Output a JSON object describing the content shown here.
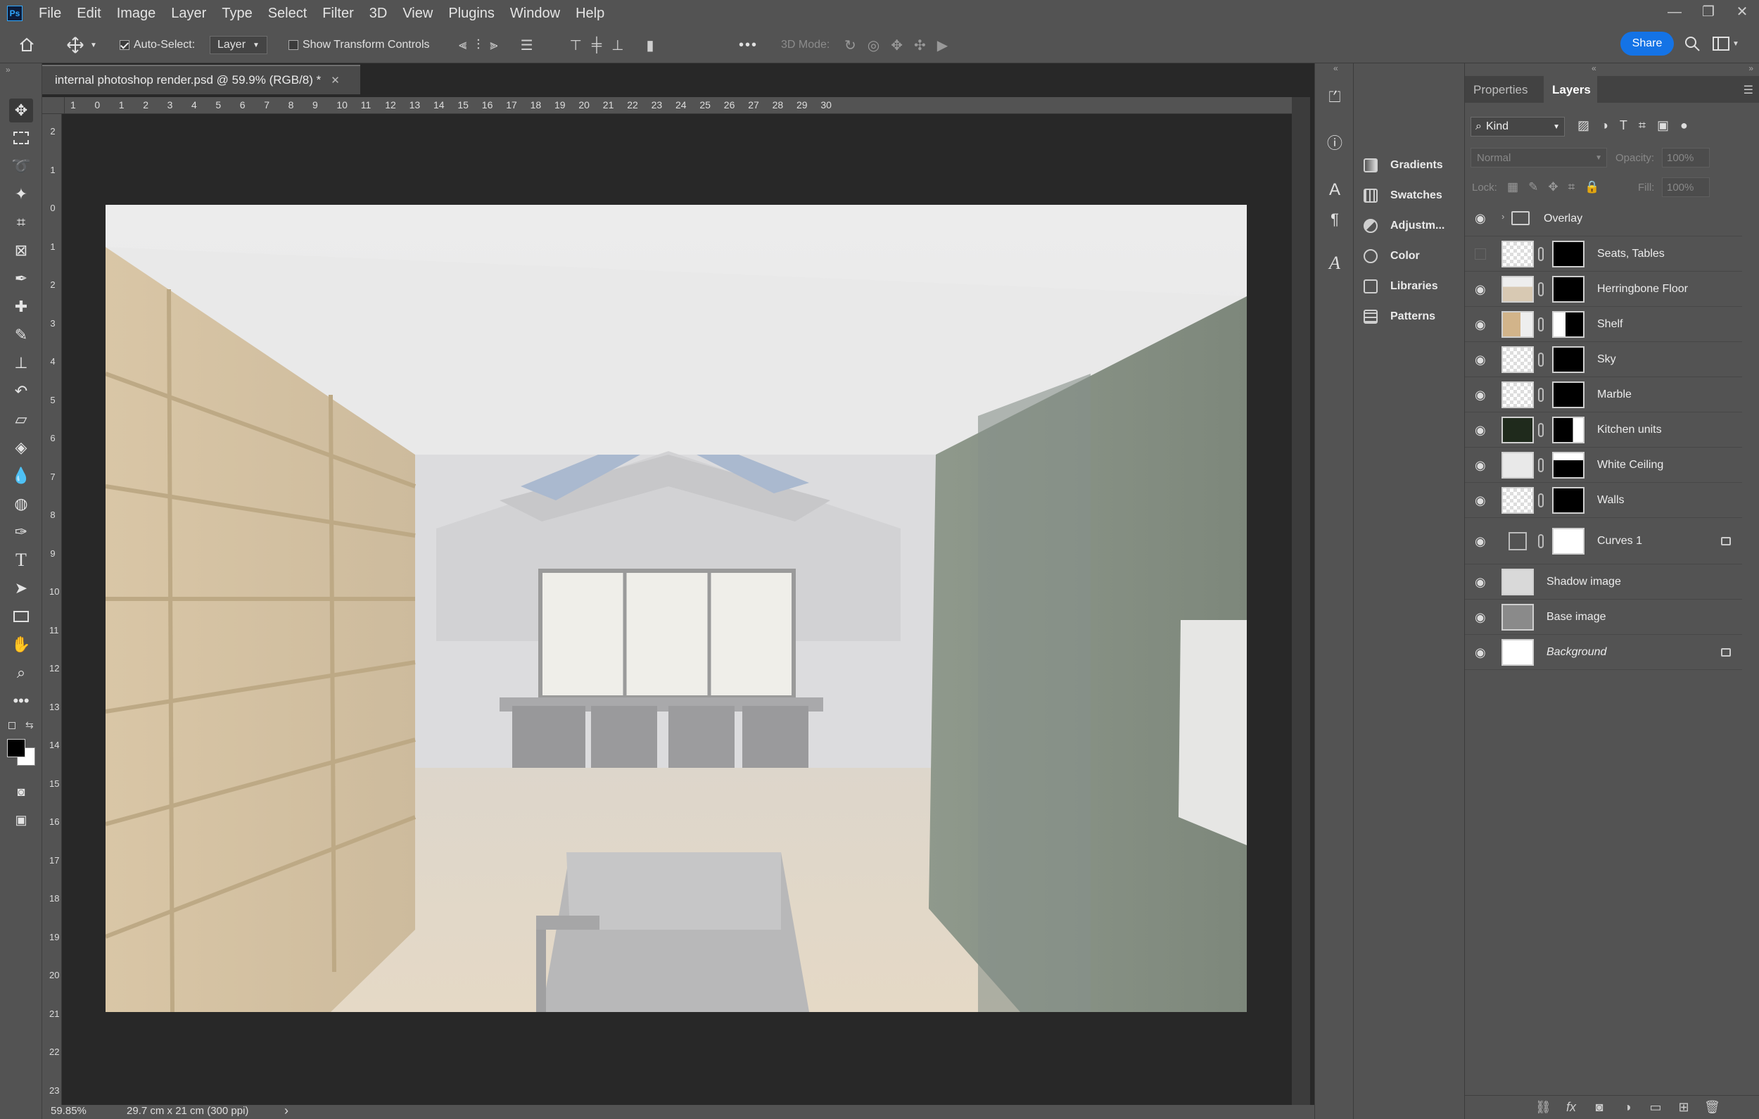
{
  "app": {
    "logo": "Ps"
  },
  "menu": [
    "File",
    "Edit",
    "Image",
    "Layer",
    "Type",
    "Select",
    "Filter",
    "3D",
    "View",
    "Plugins",
    "Window",
    "Help"
  ],
  "window_controls": {
    "minimize": "—",
    "restore": "❐",
    "close": "✕"
  },
  "options_bar": {
    "auto_select_label": "Auto-Select:",
    "auto_select_checked": true,
    "auto_select_target": "Layer",
    "show_transform_label": "Show Transform Controls",
    "show_transform_checked": false,
    "mode_3d_label": "3D Mode:",
    "more_label": "•••",
    "share_label": "Share"
  },
  "document": {
    "tab_title": "internal photoshop render.psd @ 59.9% (RGB/8) *",
    "tab_close": "✕",
    "zoom": "59.85%",
    "doc_size": "29.7 cm x 21 cm (300 ppi)",
    "status_arrow": "›"
  },
  "ruler": {
    "horizontal": [
      "1",
      "0",
      "1",
      "2",
      "3",
      "4",
      "5",
      "6",
      "7",
      "8",
      "9",
      "10",
      "11",
      "12",
      "13",
      "14",
      "15",
      "16",
      "17",
      "18",
      "19",
      "20",
      "21",
      "22",
      "23",
      "24",
      "25",
      "26",
      "27",
      "28",
      "29",
      "30"
    ],
    "vertical": [
      "2",
      "1",
      "0",
      "1",
      "2",
      "3",
      "4",
      "5",
      "6",
      "7",
      "8",
      "9",
      "10",
      "11",
      "12",
      "13",
      "14",
      "15",
      "16",
      "17",
      "18",
      "19",
      "20",
      "21",
      "22",
      "23"
    ]
  },
  "tools": [
    "move-tool",
    "marquee-tool",
    "lasso-tool",
    "magic-wand-tool",
    "crop-tool",
    "frame-tool",
    "eyedropper-tool",
    "healing-brush-tool",
    "brush-tool",
    "clone-stamp-tool",
    "history-brush-tool",
    "eraser-tool",
    "paint-bucket-tool",
    "blur-tool",
    "dodge-tool",
    "pen-tool",
    "type-tool",
    "path-selection-tool",
    "rectangle-tool",
    "hand-tool",
    "zoom-tool",
    "more-tools"
  ],
  "side_panels": [
    "Gradients",
    "Swatches",
    "Adjustm...",
    "Color",
    "Libraries",
    "Patterns"
  ],
  "layers_panel": {
    "tabs": [
      "Properties",
      "Layers"
    ],
    "filter_kind": "Kind",
    "blend_mode": "Normal",
    "opacity_label": "Opacity:",
    "opacity_value": "100%",
    "lock_label": "Lock:",
    "fill_label": "Fill:",
    "fill_value": "100%",
    "layers": [
      {
        "name": "Overlay",
        "type": "group",
        "visible": true
      },
      {
        "name": "Seats, Tables",
        "type": "masked",
        "visible": false
      },
      {
        "name": "Herringbone Floor",
        "type": "masked",
        "visible": true
      },
      {
        "name": "Shelf",
        "type": "masked",
        "visible": true
      },
      {
        "name": "Sky",
        "type": "masked",
        "visible": true
      },
      {
        "name": "Marble",
        "type": "masked",
        "visible": true
      },
      {
        "name": "Kitchen units",
        "type": "masked",
        "visible": true
      },
      {
        "name": "White Ceiling",
        "type": "masked",
        "visible": true
      },
      {
        "name": "Walls",
        "type": "masked",
        "visible": true
      },
      {
        "name": "Curves 1",
        "type": "adjustment",
        "visible": true,
        "locked": true
      },
      {
        "name": "Shadow image",
        "type": "pixel",
        "visible": true
      },
      {
        "name": "Base image",
        "type": "pixel",
        "visible": true
      },
      {
        "name": "Background",
        "type": "background",
        "visible": true,
        "locked": true
      }
    ]
  },
  "colors": {
    "accent": "#1473e6",
    "panel": "#535353",
    "canvas_bg": "#282828"
  }
}
